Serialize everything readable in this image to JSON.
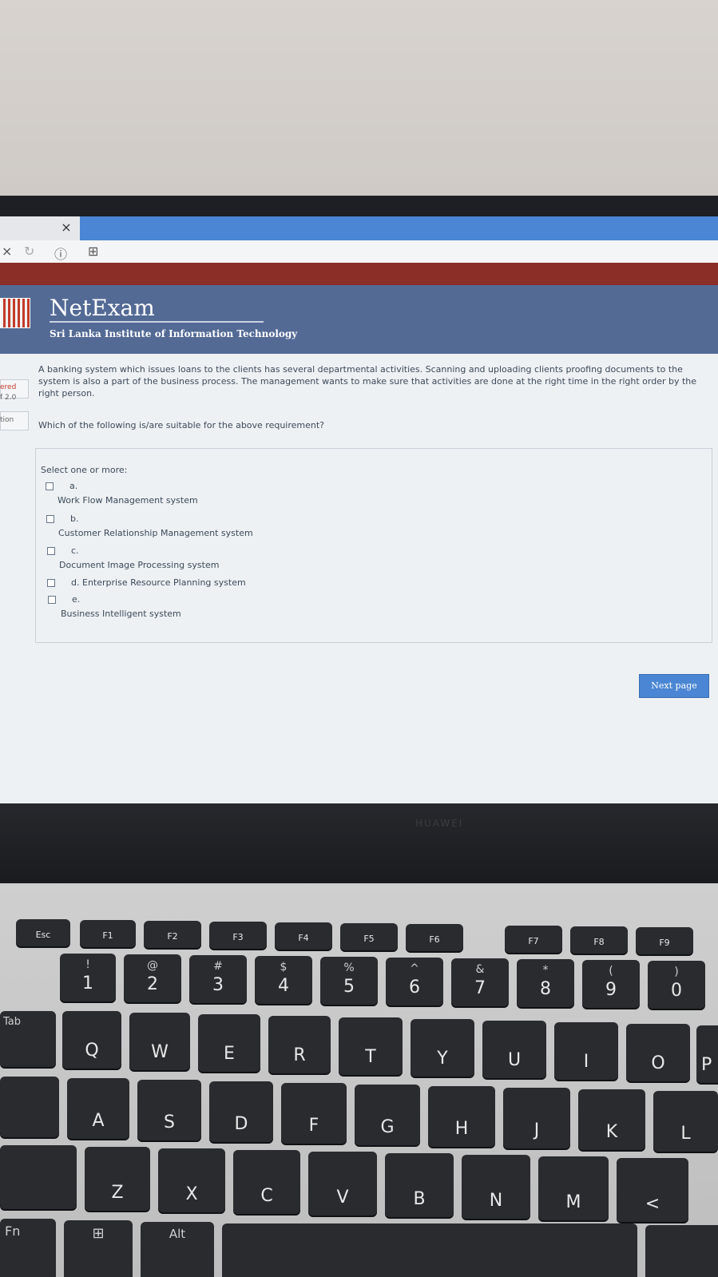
{
  "browser": {
    "tab_close": "×",
    "nav_close": "×",
    "nav_reload": "↻",
    "nav_info": "ⓘ",
    "nav_page_icon": "⊞"
  },
  "header": {
    "title": "NetExam",
    "subtitle": "Sri Lanka Institute of Information Technology"
  },
  "sidebar_fragments": [
    "ered",
    "f 2.0",
    "tion"
  ],
  "question": {
    "text": "A banking system which issues loans to the clients has several departmental activities. Scanning and uploading clients proofing documents to the system is also a part of the business process. The management wants to make sure that activities are done at the right time in the right order by the right person.",
    "prompt": "Which of the following is/are suitable for the above requirement?"
  },
  "answers": {
    "select_label": "Select one or more:",
    "options": [
      {
        "letter": "a.",
        "label": "Work Flow Management system"
      },
      {
        "letter": "b.",
        "label": "Customer Relationship Management system"
      },
      {
        "letter": "c.",
        "label": "Document Image Processing system"
      },
      {
        "letter": "d.",
        "label": "Enterprise Resource Planning system"
      },
      {
        "letter": "e.",
        "label": "Business Intelligent system"
      }
    ]
  },
  "next_button": "Next page",
  "laptop_brand": "HUAWEI",
  "keyboard": {
    "fn_row": [
      "Esc",
      "F1",
      "F2",
      "F3",
      "F4",
      "F5",
      "F6",
      "F7",
      "F8",
      "F9"
    ],
    "num_row": [
      {
        "top": "!",
        "main": "1"
      },
      {
        "top": "@",
        "main": "2"
      },
      {
        "top": "#",
        "main": "3"
      },
      {
        "top": "$",
        "main": "4"
      },
      {
        "top": "%",
        "main": "5"
      },
      {
        "top": "^",
        "main": "6"
      },
      {
        "top": "&",
        "main": "7"
      },
      {
        "top": "*",
        "main": "8"
      },
      {
        "top": "(",
        "main": "9"
      },
      {
        "top": ")",
        "main": "0"
      }
    ],
    "row_q": [
      "Q",
      "W",
      "E",
      "R",
      "T",
      "Y",
      "U",
      "I",
      "O",
      "P"
    ],
    "row_a": [
      "A",
      "S",
      "D",
      "F",
      "G",
      "H",
      "J",
      "K",
      "L"
    ],
    "row_z": [
      "Z",
      "X",
      "C",
      "V",
      "B",
      "N",
      "M",
      "<"
    ],
    "tab": "Tab",
    "fn": "Fn",
    "alt": "Alt"
  }
}
